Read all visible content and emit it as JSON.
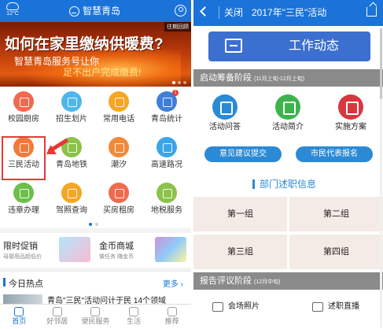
{
  "left": {
    "header": {
      "temperature": "12°C",
      "title": "智慧青岛"
    },
    "banner": {
      "tag": "往期回顾",
      "headline": "如何在家里缴纳供暖费?",
      "line2": "智慧青岛服务号让你",
      "line3": "足不出户完成缴费!"
    },
    "grid": {
      "items": [
        {
          "label": "校园厨房",
          "color": "#f06a4f"
        },
        {
          "label": "招生划片",
          "color": "#4fb6ec"
        },
        {
          "label": "常用电话",
          "color": "#f5a623"
        },
        {
          "label": "青岛统计",
          "color": "#3f7fd8",
          "badge": "1"
        },
        {
          "label": "三民活动",
          "color": "#f07a3a"
        },
        {
          "label": "青岛地铁",
          "color": "#8bc34a"
        },
        {
          "label": "潮汐",
          "color": "#f08a3a"
        },
        {
          "label": "高速路况",
          "color": "#3aa6e8"
        },
        {
          "label": "违章办理",
          "color": "#6cbf4a"
        },
        {
          "label": "驾照查询",
          "color": "#f5a623"
        },
        {
          "label": "买房租房",
          "color": "#f06a4f"
        },
        {
          "label": "地税服务",
          "color": "#8bc34a"
        }
      ]
    },
    "promos": [
      {
        "title": "限时促销",
        "subtitle": "母婴用品超低价"
      },
      {
        "title": "金币商城",
        "subtitle": "做任务 赚金币"
      }
    ],
    "hot": {
      "title": "今日热点",
      "more": "更多"
    },
    "news": {
      "headline": "青岛\"三民\"活动问计于民 14个领域"
    },
    "tabs": [
      {
        "label": "首页",
        "icon": "home-icon"
      },
      {
        "label": "好邻居",
        "icon": "neighbor-icon"
      },
      {
        "label": "便民服务",
        "icon": "service-icon"
      },
      {
        "label": "生活",
        "icon": "life-icon"
      },
      {
        "label": "推荐",
        "icon": "recommend-icon"
      }
    ]
  },
  "right": {
    "header": {
      "close": "关闭",
      "title": "2017年\"三民\"活动"
    },
    "work_button": "工作动态",
    "section1": {
      "title": "启动筹备阶段",
      "subtitle": "(11月上旬-12月上旬)"
    },
    "icons": [
      {
        "label": "活动问答",
        "color": "#2b8ad6"
      },
      {
        "label": "活动简介",
        "color": "#3cb44b"
      },
      {
        "label": "实施方案",
        "color": "#d9363e"
      }
    ],
    "pills": [
      "意见建议提交",
      "市民代表报名"
    ],
    "dept_title": "部门述职信息",
    "groups": [
      "第一组",
      "第二组",
      "第三组",
      "第四组"
    ],
    "section2": {
      "title": "报告评议阶段",
      "subtitle": "(12月中旬)"
    },
    "bottom": [
      {
        "label": "会场照片",
        "icon": "photo-icon"
      },
      {
        "label": "述职直播",
        "icon": "film-icon"
      }
    ]
  }
}
